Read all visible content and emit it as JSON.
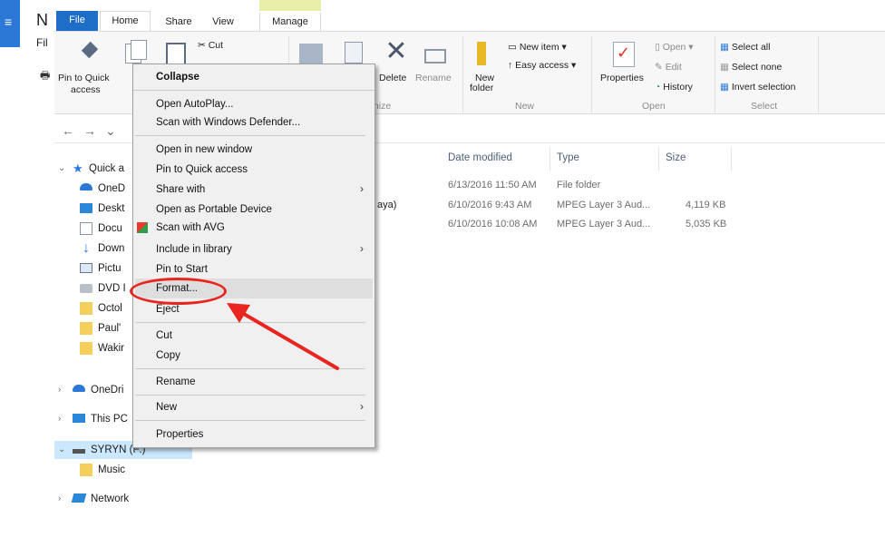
{
  "background_window": {
    "title_letter": "N",
    "subtitle": "Fil"
  },
  "ribbon": {
    "tabs": [
      "File",
      "Home",
      "Share",
      "View",
      "Manage"
    ],
    "clipboard": {
      "pin_label_1": "Pin to Quick",
      "pin_label_2": "access",
      "cut_label": "Cut"
    },
    "organize": {
      "delete_label": "Delete",
      "rename_label": "Rename",
      "group_label": "nize"
    },
    "new": {
      "new_item": "New item",
      "easy_access": "Easy access",
      "new_folder_1": "New",
      "new_folder_2": "folder",
      "group_label": "New"
    },
    "open": {
      "properties": "Properties",
      "open": "Open",
      "edit": "Edit",
      "history": "History",
      "group_label": "Open"
    },
    "select": {
      "select_all": "Select all",
      "select_none": "Select none",
      "invert": "Invert selection",
      "group_label": "Select"
    }
  },
  "nav": {
    "tree": [
      {
        "label": "Quick a"
      },
      {
        "label": "OneD"
      },
      {
        "label": "Deskt"
      },
      {
        "label": "Docu"
      },
      {
        "label": "Down"
      },
      {
        "label": "Pictu"
      },
      {
        "label": "DVD I"
      },
      {
        "label": "Octol"
      },
      {
        "label": "Paul'"
      },
      {
        "label": "Wakir"
      },
      {
        "label": "OneDri"
      },
      {
        "label": "This PC"
      },
      {
        "label": "SYRYN (F:)"
      },
      {
        "label": "Music"
      },
      {
        "label": "Network"
      }
    ]
  },
  "file_list": {
    "columns": [
      "Date modified",
      "Type",
      "Size"
    ],
    "rows": [
      {
        "name_fragment": "",
        "date": "6/13/2016 11:50 AM",
        "type": "File folder",
        "size": ""
      },
      {
        "name_fragment": "aya)",
        "date": "6/10/2016 9:43 AM",
        "type": "MPEG Layer 3 Aud...",
        "size": "4,119 KB"
      },
      {
        "name_fragment": "",
        "date": "6/10/2016 10:08 AM",
        "type": "MPEG Layer 3 Aud...",
        "size": "5,035 KB"
      }
    ]
  },
  "context_menu": {
    "items": [
      "Collapse",
      "Open AutoPlay...",
      "Scan with Windows Defender...",
      "Open in new window",
      "Pin to Quick access",
      "Share with",
      "Open as Portable Device",
      "Scan with AVG",
      "Include in library",
      "Pin to Start",
      "Format...",
      "Eject",
      "Cut",
      "Copy",
      "Rename",
      "New",
      "Properties"
    ]
  },
  "colors": {
    "accent": "#1e6ec7",
    "annotation": "#e8251f",
    "highlight": "#dedede"
  }
}
